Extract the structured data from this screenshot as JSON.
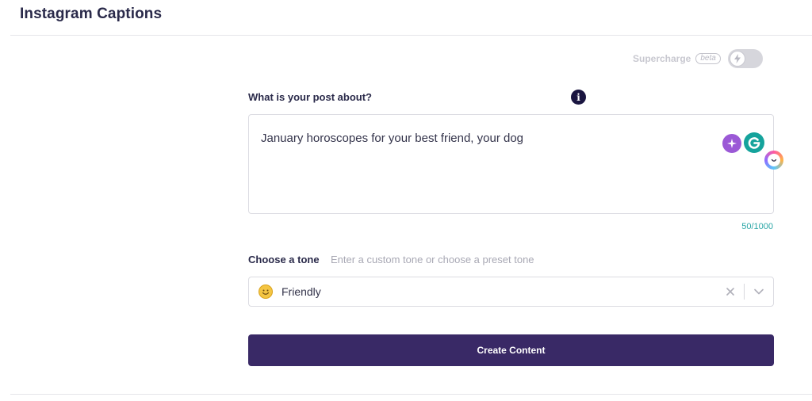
{
  "page": {
    "title": "Instagram Captions"
  },
  "supercharge": {
    "label": "Supercharge",
    "badge": "beta",
    "enabled": false,
    "toggle_icon": "bolt-icon"
  },
  "post_about": {
    "label": "What is your post about?",
    "info_icon": "i",
    "value": "January horoscopes for your best friend, your dog",
    "char_count": "50/1000"
  },
  "tone": {
    "label": "Choose a tone",
    "hint": "Enter a custom tone or choose a preset tone",
    "selected": "Friendly",
    "emoji_icon": "smiling-face-icon"
  },
  "actions": {
    "create_label": "Create Content"
  },
  "colors": {
    "primary_button": "#392966",
    "info_icon": "#1a1540",
    "char_count": "#2aa6a6",
    "grammarly": "#15a39c",
    "ai_assist": "#9b59d6"
  }
}
